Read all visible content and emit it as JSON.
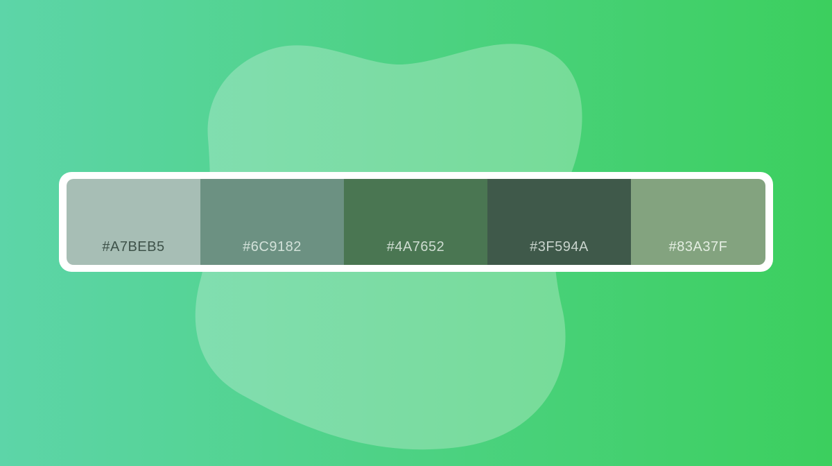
{
  "background": {
    "gradient_start": "#5DD5A8",
    "gradient_end": "#3CCF5E",
    "blob_color": "#E7F6EC"
  },
  "palette": {
    "swatches": [
      {
        "hex": "#A7BEB5",
        "label": "#A7BEB5",
        "text_color": "#3E5249"
      },
      {
        "hex": "#6C9182",
        "label": "#6C9182",
        "text_color": "#D3E2DA"
      },
      {
        "hex": "#4A7652",
        "label": "#4A7652",
        "text_color": "#CFDDD2"
      },
      {
        "hex": "#3F594A",
        "label": "#3F594A",
        "text_color": "#C9D4CD"
      },
      {
        "hex": "#83A37F",
        "label": "#83A37F",
        "text_color": "#E4EEE2"
      }
    ]
  }
}
